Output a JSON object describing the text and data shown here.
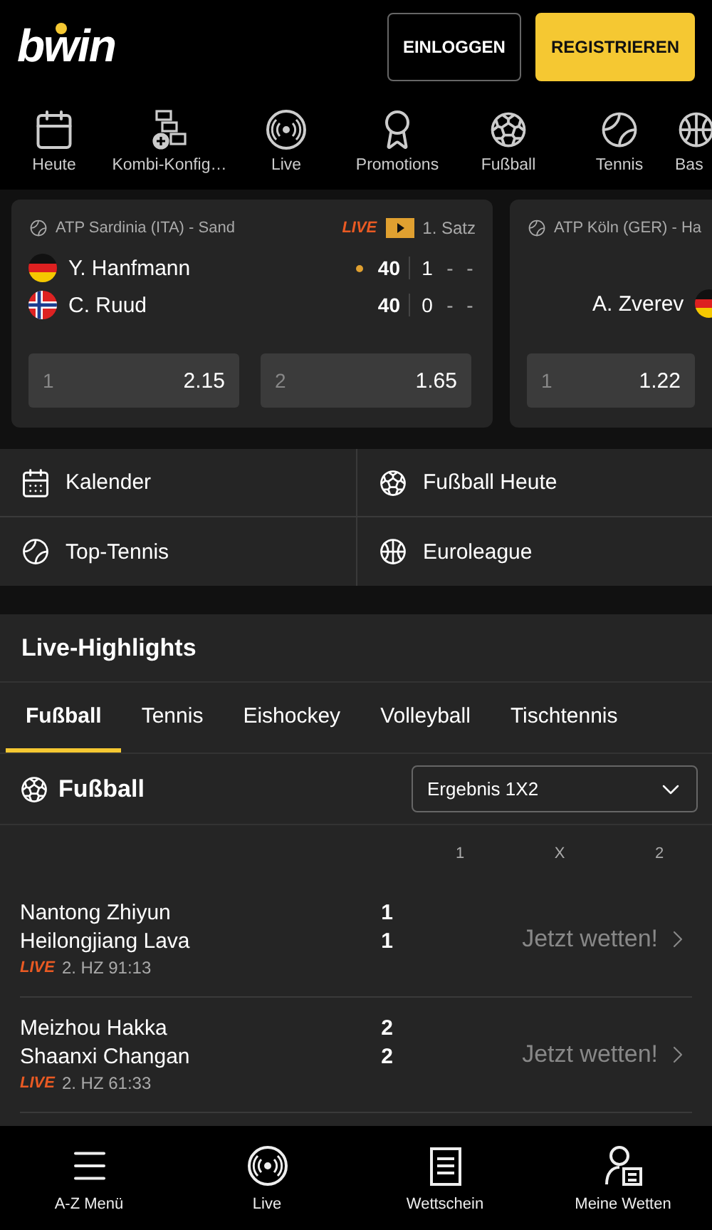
{
  "header": {
    "logo": "bwin",
    "buttons": [
      {
        "label": "EINLOGGEN",
        "kind": "outline"
      },
      {
        "label": "REGISTRIEREN",
        "kind": "primary"
      }
    ]
  },
  "nav": [
    {
      "label": "Heute",
      "kind": "calendar"
    },
    {
      "label": "Kombi-Konfig…",
      "kind": "combo"
    },
    {
      "label": "Live",
      "kind": "live"
    },
    {
      "label": "Promotions",
      "kind": "award"
    },
    {
      "label": "Fußball",
      "kind": "football"
    },
    {
      "label": "Tennis",
      "kind": "tennis"
    },
    {
      "label": "Bas",
      "kind": "basketball"
    }
  ],
  "match_cards": [
    {
      "kind": "scoreboard",
      "league": "ATP Sardinia (ITA) - Sand",
      "live_label": "LIVE",
      "period": "1. Satz",
      "players": [
        {
          "name": "Y. Hanfmann",
          "kind": "de",
          "serving": true,
          "points": "40",
          "sets": [
            "1",
            "-",
            "-"
          ]
        },
        {
          "name": "C. Ruud",
          "kind": "no",
          "serving": false,
          "points": "40",
          "sets": [
            "0",
            "-",
            "-"
          ]
        }
      ],
      "odds": [
        {
          "label": "1",
          "value": "2.15"
        },
        {
          "label": "2",
          "value": "1.65"
        }
      ]
    },
    {
      "kind": "versus",
      "league": "ATP Köln (GER) - Ha",
      "players": [
        {
          "name": "A. Zverev",
          "kind": "de"
        }
      ],
      "odds": [
        {
          "label": "1",
          "value": "1.22"
        }
      ]
    }
  ],
  "quick_links": [
    {
      "label": "Kalender",
      "kind": "calendar-grid"
    },
    {
      "label": "Fußball Heute",
      "kind": "football"
    },
    {
      "label": "Top-Tennis",
      "kind": "tennis"
    },
    {
      "label": "Euroleague",
      "kind": "basketball"
    }
  ],
  "live_highlights": {
    "title": "Live-Highlights",
    "tabs": [
      {
        "label": "Fußball",
        "selected": true
      },
      {
        "label": "Tennis",
        "selected": false
      },
      {
        "label": "Eishockey",
        "selected": false
      },
      {
        "label": "Volleyball",
        "selected": false
      },
      {
        "label": "Tischtennis",
        "selected": false
      }
    ],
    "sport": {
      "title": "Fußball",
      "kind": "football"
    },
    "market": {
      "value": "Ergebnis 1X2"
    },
    "columns": [
      "1",
      "X",
      "2"
    ],
    "events": [
      {
        "teams": [
          {
            "name": "Nantong Zhiyun",
            "score": "1"
          },
          {
            "name": "Heilongjiang Lava",
            "score": "1"
          }
        ],
        "live_label": "LIVE",
        "time": "2. HZ 91:13",
        "cta": "Jetzt wetten!"
      },
      {
        "teams": [
          {
            "name": "Meizhou Hakka",
            "score": "2"
          },
          {
            "name": "Shaanxi Changan",
            "score": "2"
          }
        ],
        "live_label": "LIVE",
        "time": "2. HZ 61:33",
        "cta": "Jetzt wetten!"
      }
    ]
  },
  "bottom_nav": [
    {
      "label": "A-Z Menü",
      "kind": "menu"
    },
    {
      "label": "Live",
      "kind": "live"
    },
    {
      "label": "Wettschein",
      "kind": "slip"
    },
    {
      "label": "Meine Wetten",
      "kind": "mybets"
    }
  ]
}
